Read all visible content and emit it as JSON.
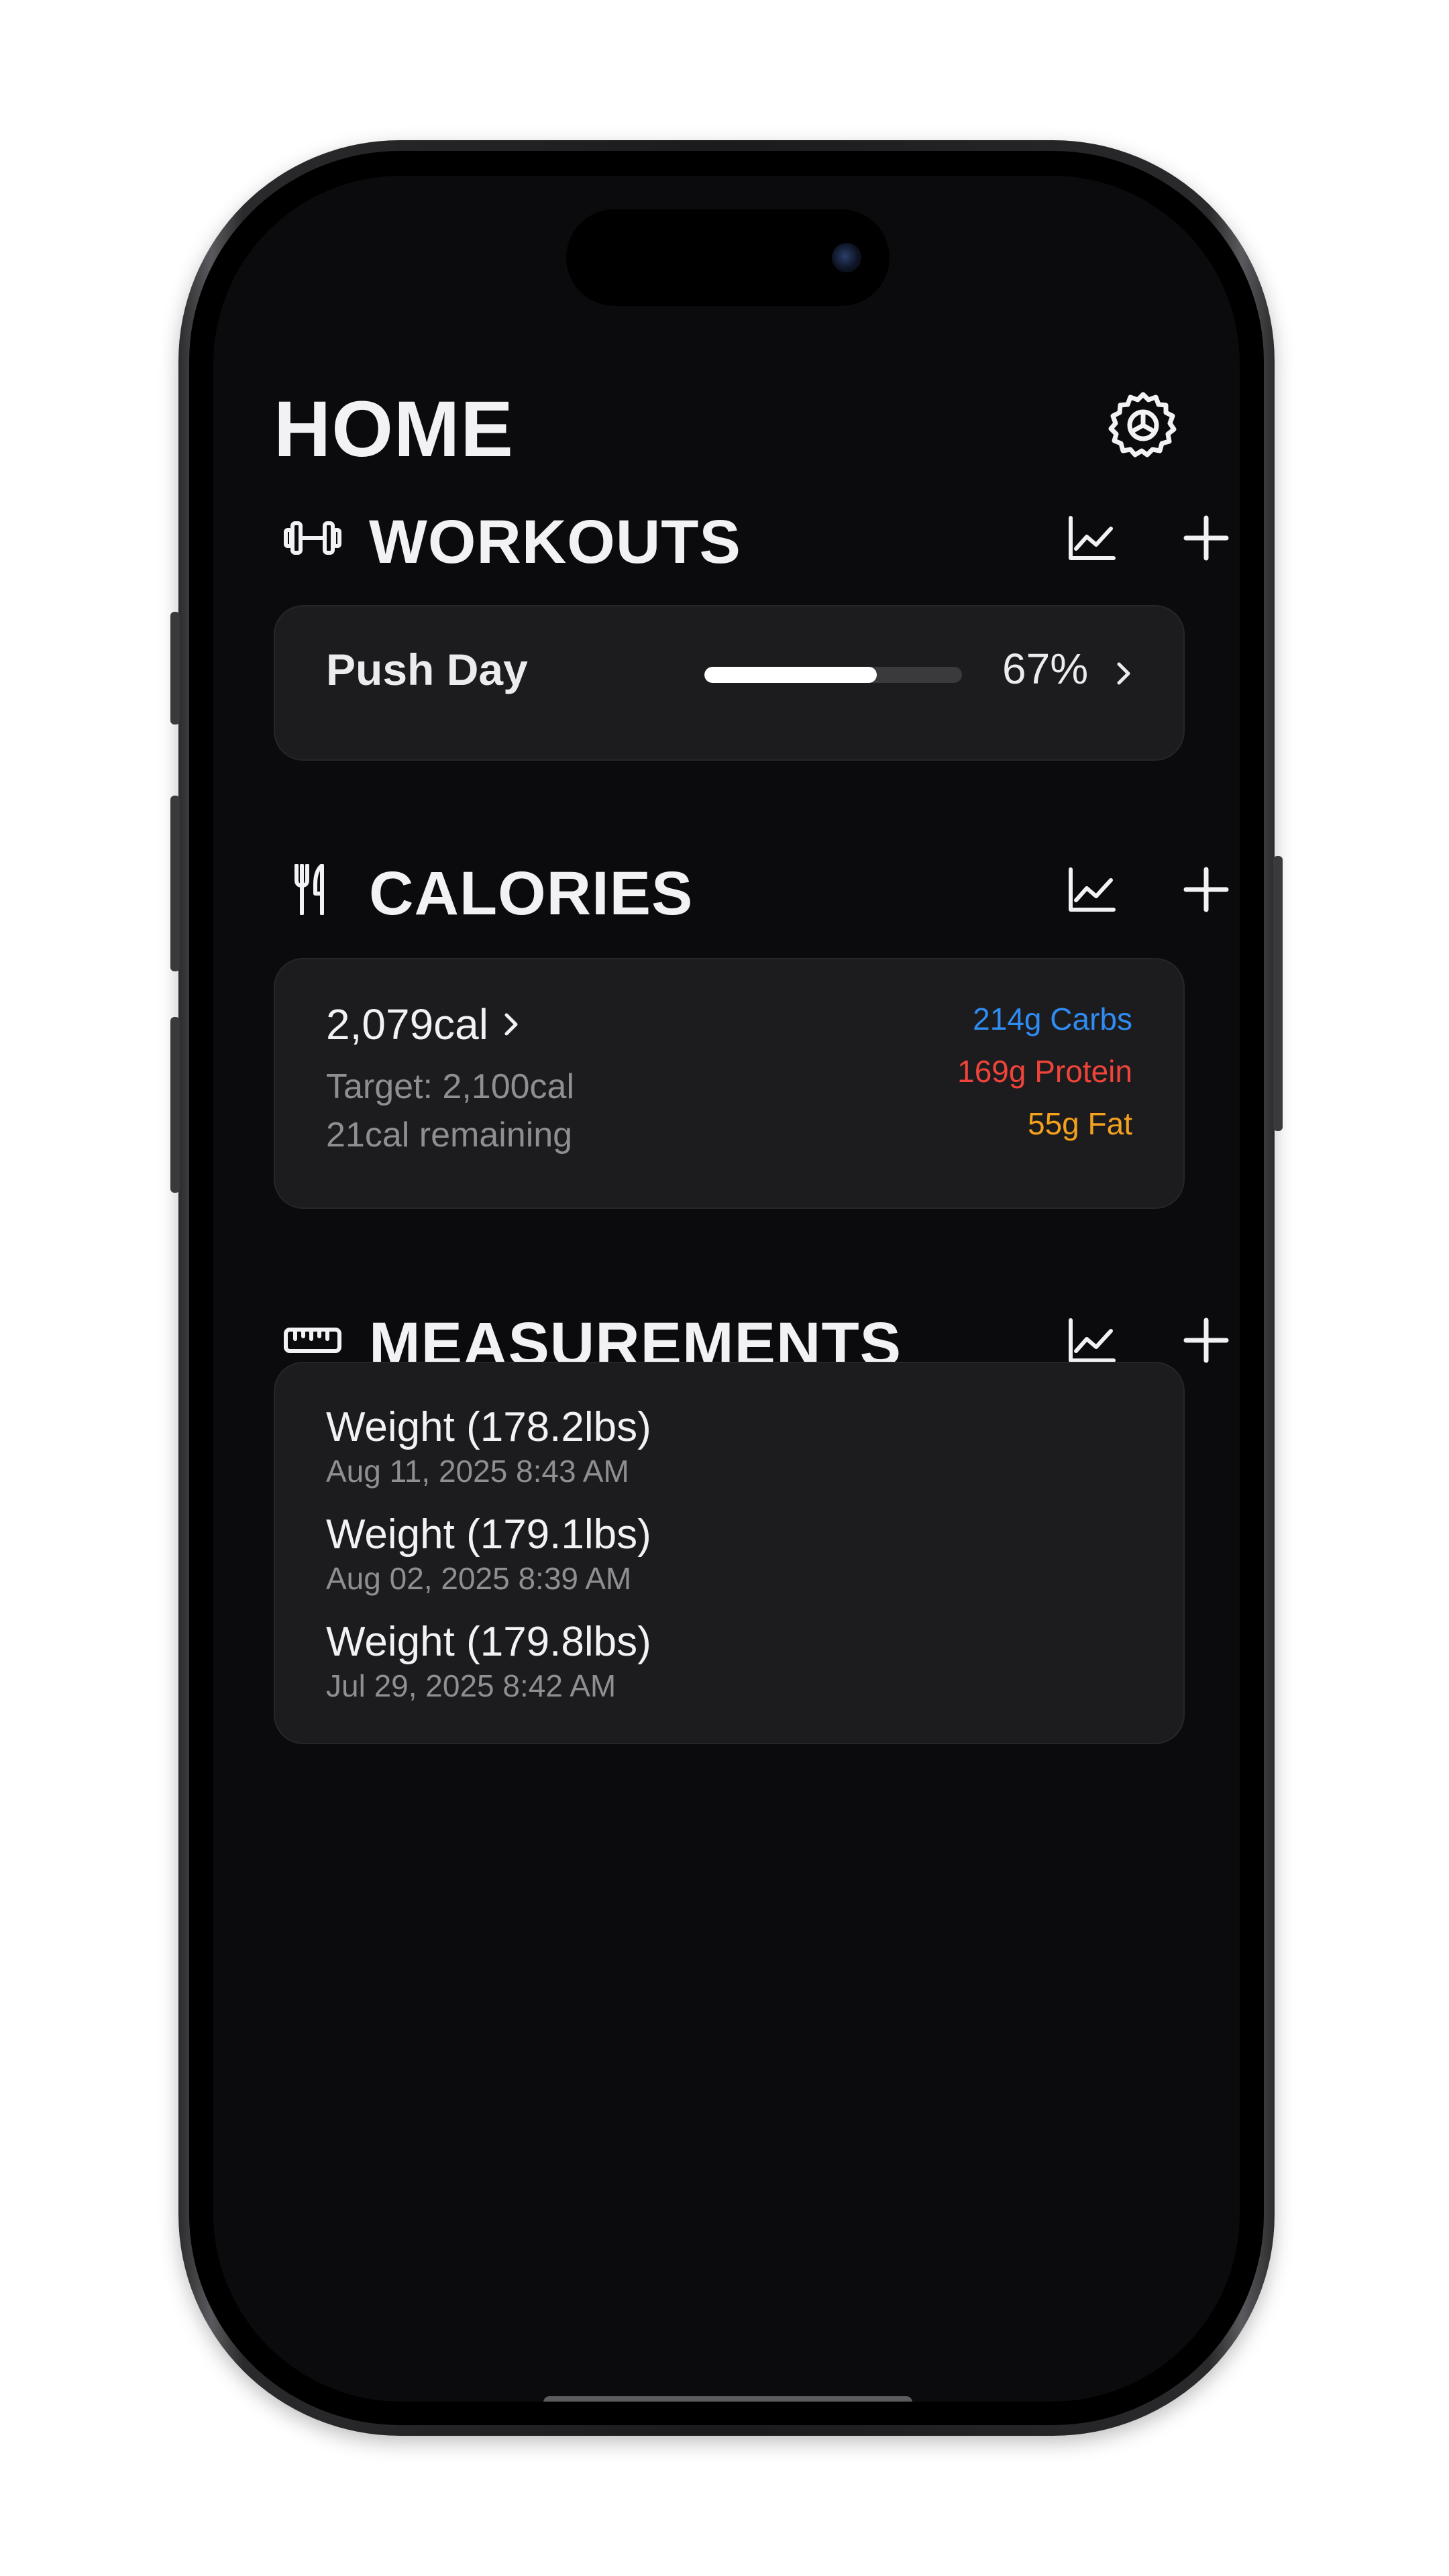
{
  "header": {
    "title": "HOME"
  },
  "sections": {
    "workouts": {
      "title": "WORKOUTS",
      "item": {
        "name": "Push Day",
        "progress_label": "67%",
        "progress_fraction": 0.67
      }
    },
    "calories": {
      "title": "CALORIES",
      "consumed": "2,079cal",
      "target": "Target: 2,100cal",
      "remaining": "21cal remaining",
      "macros": {
        "carbs": "214g Carbs",
        "protein": "169g Protein",
        "fat": "55g Fat"
      }
    },
    "measurements": {
      "title": "MEASUREMENTS",
      "entries": [
        {
          "label": "Weight (178.2lbs)",
          "date": "Aug 11, 2025 8:43 AM"
        },
        {
          "label": "Weight (179.1lbs)",
          "date": "Aug 02, 2025 8:39 AM"
        },
        {
          "label": "Weight (179.8lbs)",
          "date": "Jul 29, 2025 8:42 AM"
        }
      ]
    }
  },
  "icons": {
    "settings": "gear-icon",
    "workouts": "dumbbell-icon",
    "calories": "fork-knife-icon",
    "measurements": "ruler-icon",
    "chart": "line-chart-icon",
    "add": "plus-icon",
    "chevron": "chevron-right-icon"
  },
  "colors": {
    "background": "#0b0b0d",
    "card": "#1c1c1e",
    "carbs": "#2f8cf3",
    "protein": "#f0443a",
    "fat": "#f4a11e",
    "secondary_text": "#8e8e93"
  }
}
